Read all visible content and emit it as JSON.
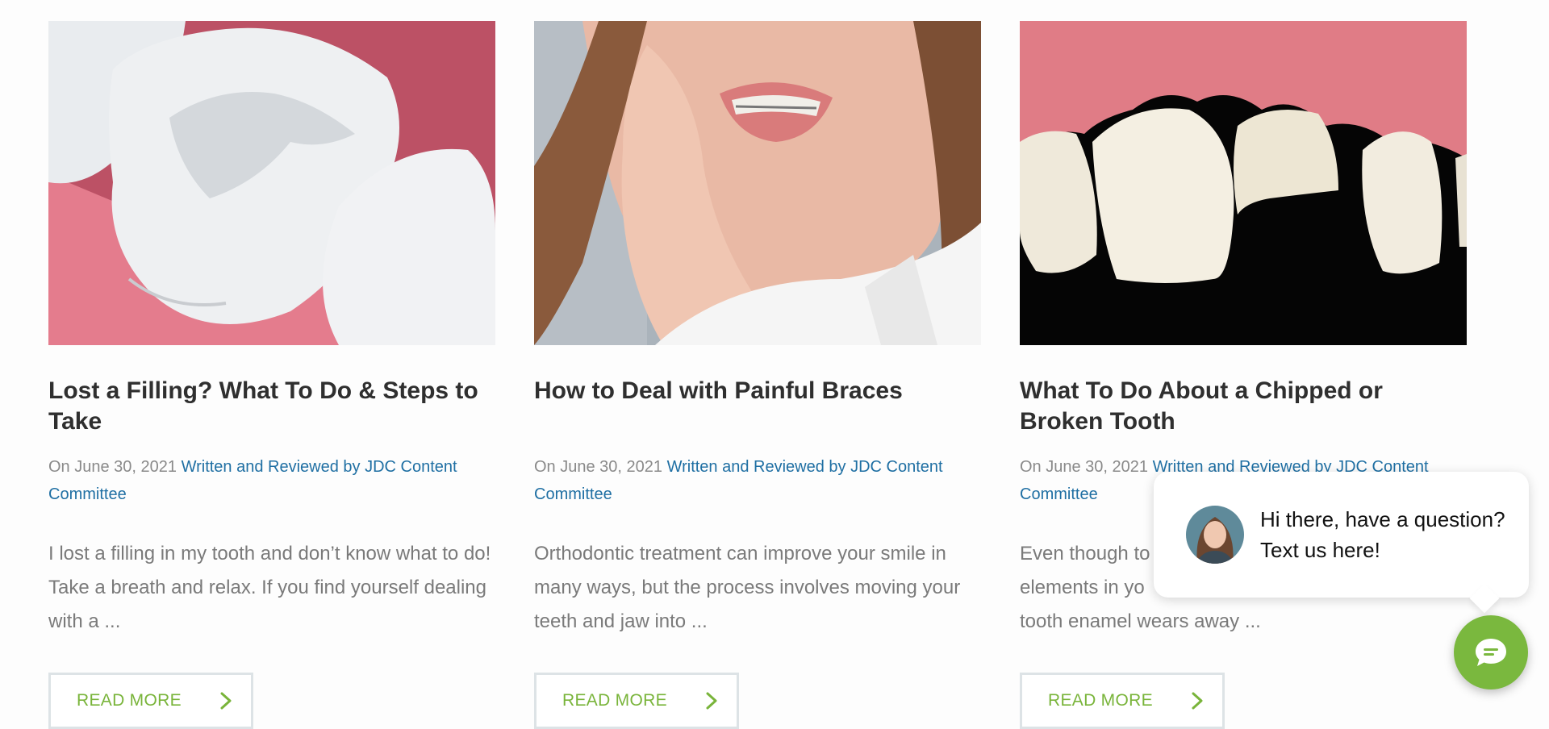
{
  "posts": [
    {
      "title": "Lost a Filling? What To Do & Steps to Take",
      "date": "On June 30, 2021",
      "author": "Written and Reviewed by JDC Content Committee",
      "excerpt": "I lost a filling in my tooth and don’t know what to do! Take a breath and relax. If you find yourself dealing with a ...",
      "read_more": "READ MORE",
      "image": "missing-filling-molar-illustration"
    },
    {
      "title": "How to Deal with Painful Braces",
      "date": "On June 30, 2021",
      "author": "Written and Reviewed by JDC Content Committee",
      "excerpt": "Orthodontic treatment can improve your smile in many ways, but the process involves moving your teeth and jaw into ...",
      "read_more": "READ MORE",
      "image": "woman-holding-cheek-with-braces"
    },
    {
      "title": "What To Do About a Chipped or Broken Tooth",
      "date": "On June 30, 2021",
      "author": "Written and Reviewed by JDC Content Committee",
      "excerpt": "Even though tooth enamel is one of the hardest elements in your body, it can still break down. When tooth enamel wears away ...",
      "excerpt_visible": [
        "Even though to",
        "elements in yo",
        "tooth enamel wears away ..."
      ],
      "read_more": "READ MORE",
      "image": "chipped-front-tooth-illustration"
    }
  ],
  "chat": {
    "message": "Hi there, have a question? Text us here!",
    "launcher_icon": "chat-bubble-icon",
    "accent": "#7ab83e"
  },
  "colors": {
    "link": "#1f6fa3",
    "accent": "#79b43a",
    "title": "#2f2f2f",
    "meta": "#8a8a8a"
  }
}
